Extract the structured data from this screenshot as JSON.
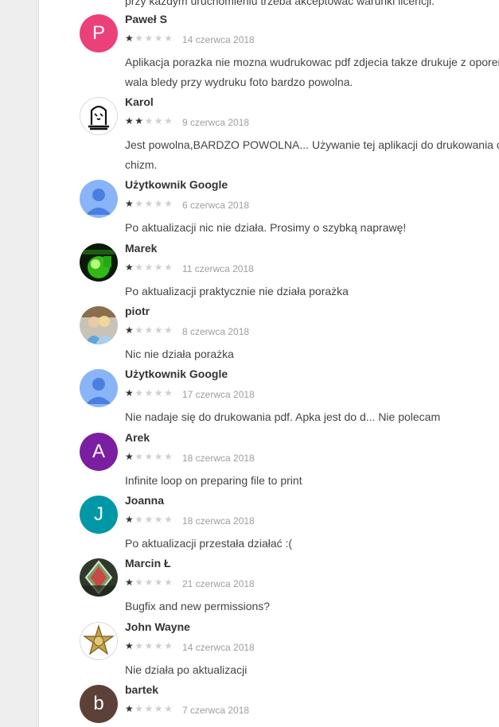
{
  "partial_previous_review": "przy każdym uruchomieniu trzeba akceptować warunki licencji.",
  "reviews": [
    {
      "author": "Paweł S",
      "rating": 1,
      "date": "14 czerwca 2018",
      "body_lines": [
        "Aplikacja porazka nie mozna wudrukowac pdf zdjecia takze drukuje z oporem",
        "wala bledy przy wydruku foto bardzo powolna."
      ],
      "avatar": {
        "type": "letter",
        "letter": "P",
        "color": "#ec407a"
      }
    },
    {
      "author": "Karol",
      "rating": 2,
      "date": "9 czerwca 2018",
      "body_lines": [
        "Jest powolna,BARDZO POWOLNA... Używanie tej aplikacji do drukowania oci",
        "chizm."
      ],
      "avatar": {
        "type": "drawing",
        "icon": "sketch-avatar-icon"
      }
    },
    {
      "author": "Użytkownik Google",
      "rating": 1,
      "date": "6 czerwca 2018",
      "body_lines": [
        "Po aktualizacji nic nie działa. Prosimy o szybką naprawę!"
      ],
      "avatar": {
        "type": "default",
        "icon": "default-user-icon",
        "color": "#8ab4f8"
      }
    },
    {
      "author": "Marek",
      "rating": 1,
      "date": "11 czerwca 2018",
      "body_lines": [
        "Po aktualizacji praktycznie nie działa porażka"
      ],
      "avatar": {
        "type": "photo",
        "icon": "green-light-photo-icon"
      }
    },
    {
      "author": "piotr",
      "rating": 1,
      "date": "8 czerwca 2018",
      "body_lines": [
        "Nic nie działa porażka"
      ],
      "avatar": {
        "type": "photo",
        "icon": "people-photo-icon"
      }
    },
    {
      "author": "Użytkownik Google",
      "rating": 1,
      "date": "17 czerwca 2018",
      "body_lines": [
        "Nie nadaje się do drukowania pdf. Apka jest do d... Nie polecam"
      ],
      "avatar": {
        "type": "default",
        "icon": "default-user-icon",
        "color": "#8ab4f8"
      }
    },
    {
      "author": "Arek",
      "rating": 1,
      "date": "18 czerwca 2018",
      "body_lines": [
        "Infinite loop on preparing file to print"
      ],
      "avatar": {
        "type": "letter",
        "letter": "A",
        "color": "#7b1fa2"
      }
    },
    {
      "author": "Joanna",
      "rating": 1,
      "date": "18 czerwca 2018",
      "body_lines": [
        "Po aktualizacji przestała działać :("
      ],
      "avatar": {
        "type": "letter",
        "letter": "J",
        "color": "#0097a7"
      }
    },
    {
      "author": "Marcin Ł",
      "rating": 1,
      "date": "21 czerwca 2018",
      "body_lines": [
        "Bugfix and new permissions?"
      ],
      "avatar": {
        "type": "photo",
        "icon": "diamond-photo-icon"
      }
    },
    {
      "author": "John Wayne",
      "rating": 1,
      "date": "14 czerwca 2018",
      "body_lines": [
        "Nie działa po aktualizacji"
      ],
      "avatar": {
        "type": "photo",
        "icon": "sheriff-badge-icon"
      }
    },
    {
      "author": "bartek",
      "rating": 1,
      "date": "7 czerwca 2018",
      "body_lines": [],
      "avatar": {
        "type": "letter",
        "letter": "b",
        "color": "#5d4037"
      }
    }
  ],
  "max_rating": 5
}
